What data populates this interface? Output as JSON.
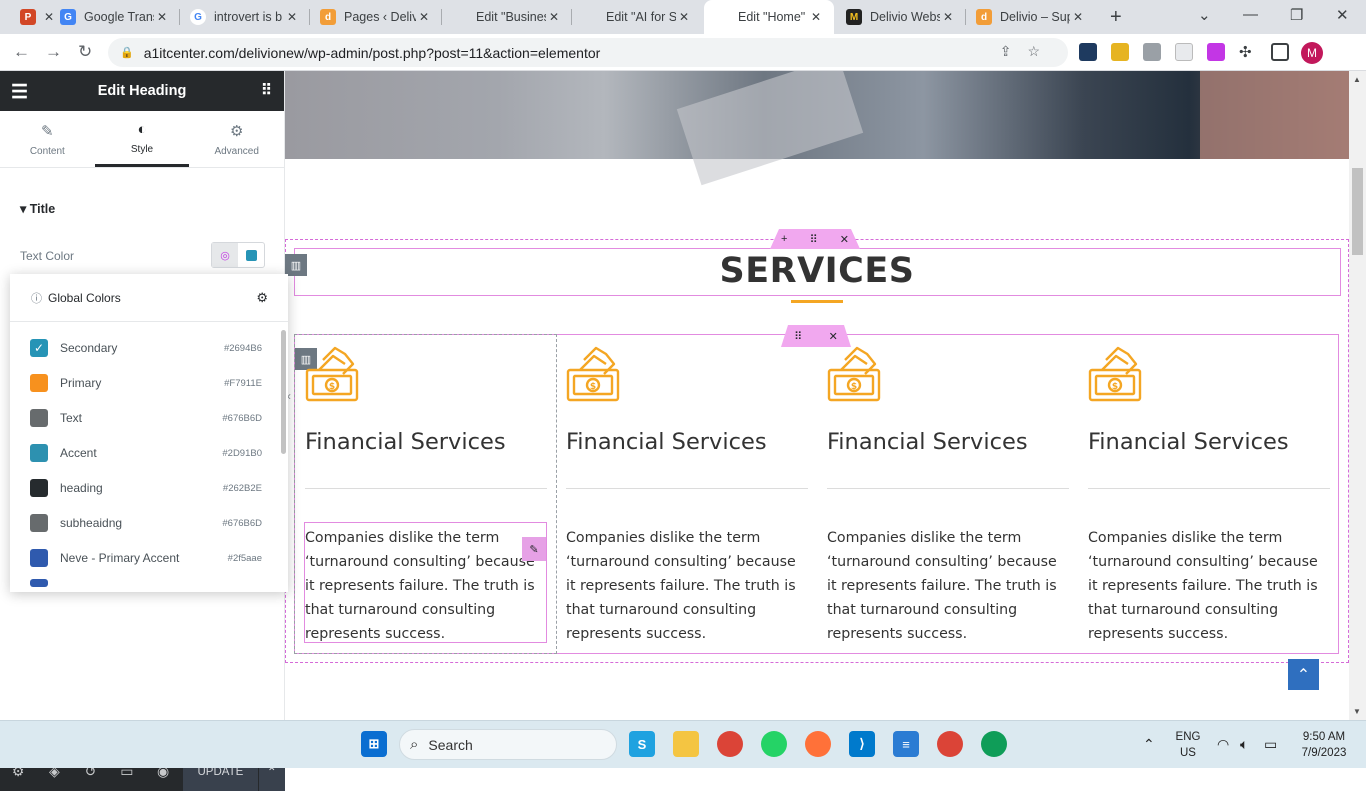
{
  "browser": {
    "tabs": [
      {
        "title": "",
        "favicon_color": "#d24726",
        "favicon_letter": "P"
      },
      {
        "title": "Google Transl",
        "favicon_color": "#4285f4",
        "favicon_letter": "G"
      },
      {
        "title": "introvert is b",
        "favicon_color": "#ffffff",
        "favicon_letter": "G"
      },
      {
        "title": "Pages ‹ Deliv",
        "favicon_color": "#f29d38",
        "favicon_letter": "d"
      },
      {
        "title": "Edit \"Busines",
        "favicon_color": "",
        "favicon_letter": ""
      },
      {
        "title": "Edit \"AI for S",
        "favicon_color": "",
        "favicon_letter": ""
      },
      {
        "title": "Edit \"Home\"",
        "favicon_color": "",
        "favicon_letter": ""
      },
      {
        "title": "Delivio Webs",
        "favicon_color": "#222222",
        "favicon_letter": "M"
      },
      {
        "title": "Delivio – Sup",
        "favicon_color": "#f29d38",
        "favicon_letter": "d"
      }
    ],
    "active_tab": 6,
    "url": "a1itcenter.com/delivionew/wp-admin/post.php?post=11&action=elementor",
    "avatar_letter": "M"
  },
  "panel": {
    "title": "Edit Heading",
    "tabs": [
      {
        "label": "Content",
        "icon": "pencil-icon"
      },
      {
        "label": "Style",
        "icon": "contrast-icon"
      },
      {
        "label": "Advanced",
        "icon": "gear-icon"
      }
    ],
    "section_title": "Title",
    "text_color_label": "Text Color",
    "global_colors": {
      "title": "Global Colors",
      "items": [
        {
          "name": "Secondary",
          "hex": "#2694B6",
          "color": "#2694B6",
          "checked": true
        },
        {
          "name": "Primary",
          "hex": "#F7911E",
          "color": "#F7911E",
          "checked": false
        },
        {
          "name": "Text",
          "hex": "#676B6D",
          "color": "#676B6D",
          "checked": false
        },
        {
          "name": "Accent",
          "hex": "#2D91B0",
          "color": "#2D91B0",
          "checked": false
        },
        {
          "name": "heading",
          "hex": "#262B2E",
          "color": "#262B2E",
          "checked": false
        },
        {
          "name": "subheaidng",
          "hex": "#676B6D",
          "color": "#676B6D",
          "checked": false
        },
        {
          "name": "Neve - Primary Accent",
          "hex": "#2f5aae",
          "color": "#2f5aae",
          "checked": false
        }
      ]
    },
    "update_label": "UPDATE"
  },
  "canvas": {
    "section_title": "SERVICES",
    "services": [
      {
        "title": "Financial Services",
        "text": "Companies dislike the term ‘turnaround consulting’ because it represents failure. The truth is that turnaround consulting represents success."
      },
      {
        "title": "Financial Services",
        "text": "Companies dislike the term ‘turnaround consulting’ because it represents failure. The truth is that turnaround consulting represents success."
      },
      {
        "title": "Financial Services",
        "text": "Companies dislike the term ‘turnaround consulting’ because it represents failure. The truth is that turnaround consulting represents success."
      },
      {
        "title": "Financial Services",
        "text": "Companies dislike the term ‘turnaround consulting’ because it represents failure. The truth is that turnaround consulting represents success."
      }
    ],
    "accent_color": "#f4a623"
  },
  "taskbar": {
    "search_placeholder": "Search",
    "lang_top": "ENG",
    "lang_bottom": "US",
    "time": "9:50 AM",
    "date": "7/9/2023"
  }
}
